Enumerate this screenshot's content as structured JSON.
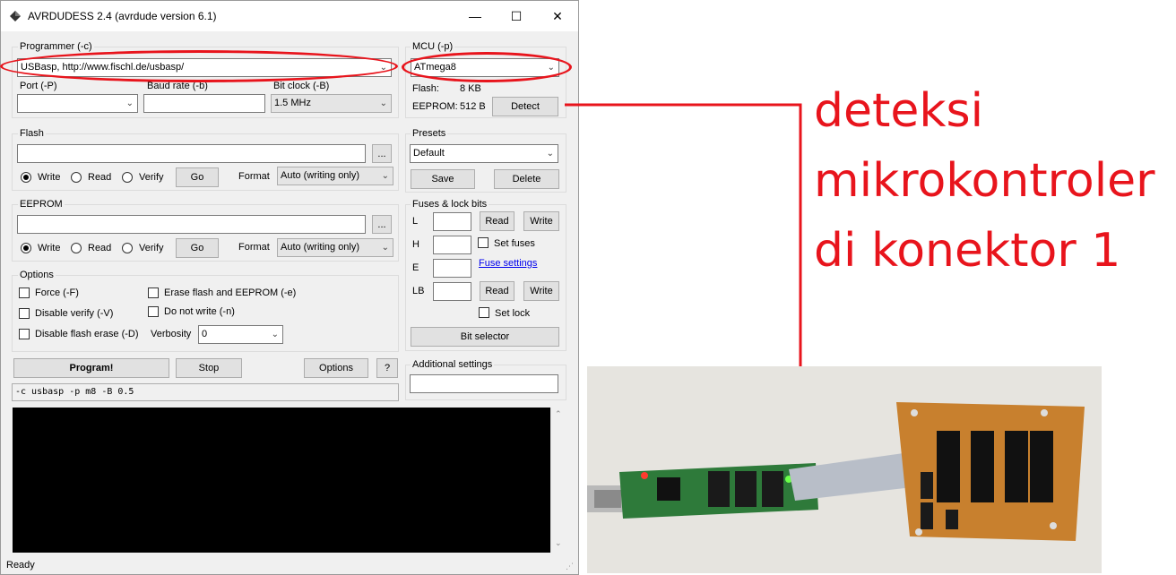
{
  "window": {
    "title": "AVRDUDESS 2.4 (avrdude version 6.1)",
    "controls": {
      "minimize": "—",
      "maximize": "☐",
      "close": "✕"
    }
  },
  "programmer": {
    "label": "Programmer (-c)",
    "value": "USBasp, http://www.fischl.de/usbasp/",
    "port_label": "Port (-P)",
    "port_value": "",
    "baud_label": "Baud rate (-b)",
    "baud_value": "",
    "bitclock_label": "Bit clock (-B)",
    "bitclock_value": "1.5 MHz"
  },
  "mcu": {
    "label": "MCU (-p)",
    "value": "ATmega8",
    "flash_label": "Flash:",
    "flash_value": "8 KB",
    "eeprom_label": "EEPROM:",
    "eeprom_value": "512 B",
    "detect": "Detect"
  },
  "flash": {
    "label": "Flash",
    "browse": "...",
    "write": "Write",
    "read": "Read",
    "verify": "Verify",
    "go": "Go",
    "format_label": "Format",
    "format_value": "Auto (writing only)"
  },
  "eeprom": {
    "label": "EEPROM",
    "browse": "...",
    "write": "Write",
    "read": "Read",
    "verify": "Verify",
    "go": "Go",
    "format_label": "Format",
    "format_value": "Auto (writing only)"
  },
  "presets": {
    "label": "Presets",
    "value": "Default",
    "save": "Save",
    "delete": "Delete"
  },
  "fuses": {
    "label": "Fuses & lock bits",
    "l": "L",
    "h": "H",
    "e": "E",
    "lb": "LB",
    "read": "Read",
    "write": "Write",
    "set_fuses": "Set fuses",
    "fuse_settings": "Fuse settings",
    "set_lock": "Set lock",
    "bit_selector": "Bit selector"
  },
  "options": {
    "label": "Options",
    "force": "Force (-F)",
    "erase": "Erase flash and EEPROM (-e)",
    "disable_verify": "Disable verify (-V)",
    "do_not_write": "Do not write (-n)",
    "disable_flash_erase": "Disable flash erase (-D)",
    "verbosity_label": "Verbosity",
    "verbosity_value": "0"
  },
  "actions": {
    "program": "Program!",
    "stop": "Stop",
    "options": "Options",
    "help": "?"
  },
  "additional": {
    "label": "Additional settings",
    "value": ""
  },
  "command_line": "-c usbasp -p m8 -B 0.5",
  "status": "Ready",
  "annotation": {
    "line1": "deteksi",
    "line2": "mikrokontroler",
    "line3": "di konektor 1"
  },
  "colors": {
    "annotation_red": "#e8141c",
    "console_bg": "#000000"
  }
}
